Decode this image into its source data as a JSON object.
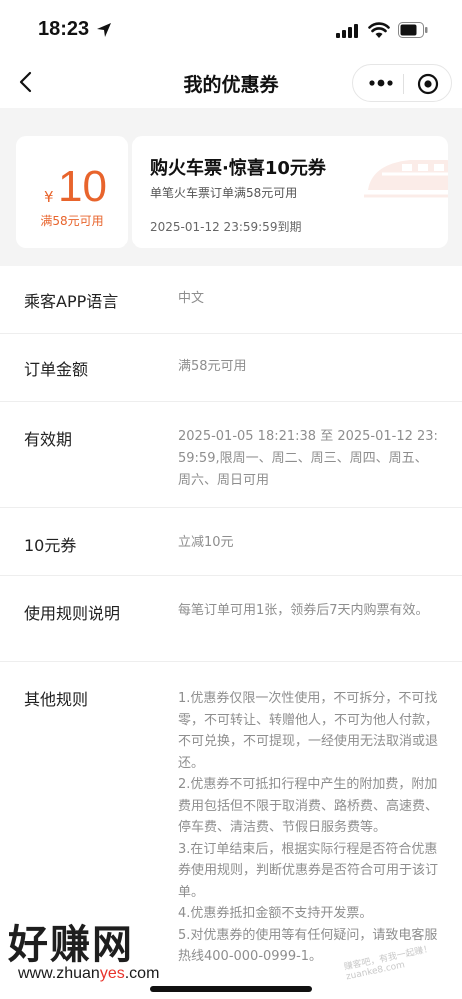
{
  "status_bar": {
    "time": "18:23"
  },
  "nav": {
    "title": "我的优惠券"
  },
  "coupon": {
    "currency": "¥",
    "amount": "10",
    "min_spend": "满58元可用",
    "title": "购火车票·惊喜10元券",
    "description": "单笔火车票订单满58元可用",
    "expiry": "2025-01-12 23:59:59到期"
  },
  "details": [
    {
      "label": "乘客APP语言",
      "value": "中文"
    },
    {
      "label": "订单金额",
      "value": "满58元可用"
    },
    {
      "label": "有效期",
      "value": "2025-01-05 18:21:38 至 2025-01-12 23:59:59,限周一、周二、周三、周四、周五、周六、周日可用"
    },
    {
      "label": "10元券",
      "value": "立减10元"
    },
    {
      "label": "使用规则说明",
      "value": "每笔订单可用1张，领券后7天内购票有效。"
    },
    {
      "label": "其他规则",
      "value": "1.优惠券仅限一次性使用，不可拆分，不可找零，不可转让、转赠他人，不可为他人付款，不可兑换，不可提现，一经使用无法取消或退还。\n2.优惠券不可抵扣行程中产生的附加费，附加费用包括但不限于取消费、路桥费、高速费、停车费、清洁费、节假日服务费等。\n3.在订单结束后，根据实际行程是否符合优惠券使用规则，判断优惠券是否符合可用于该订单。\n4.优惠券抵扣金额不支持开发票。\n5.对优惠券的使用等有任何疑问，请致电客服热线400-000-0999-1。"
    }
  ],
  "watermark": {
    "logo": "好赚网",
    "url_prefix": "www.zhuan",
    "url_highlight": "yes",
    "url_suffix": ".com",
    "stamp": "赚客吧，有我一起赚！ zuanke8.com"
  },
  "colors": {
    "accent": "#e8642c",
    "muted": "#8e8e8e",
    "coupon_bg": "#f4f4f4"
  }
}
